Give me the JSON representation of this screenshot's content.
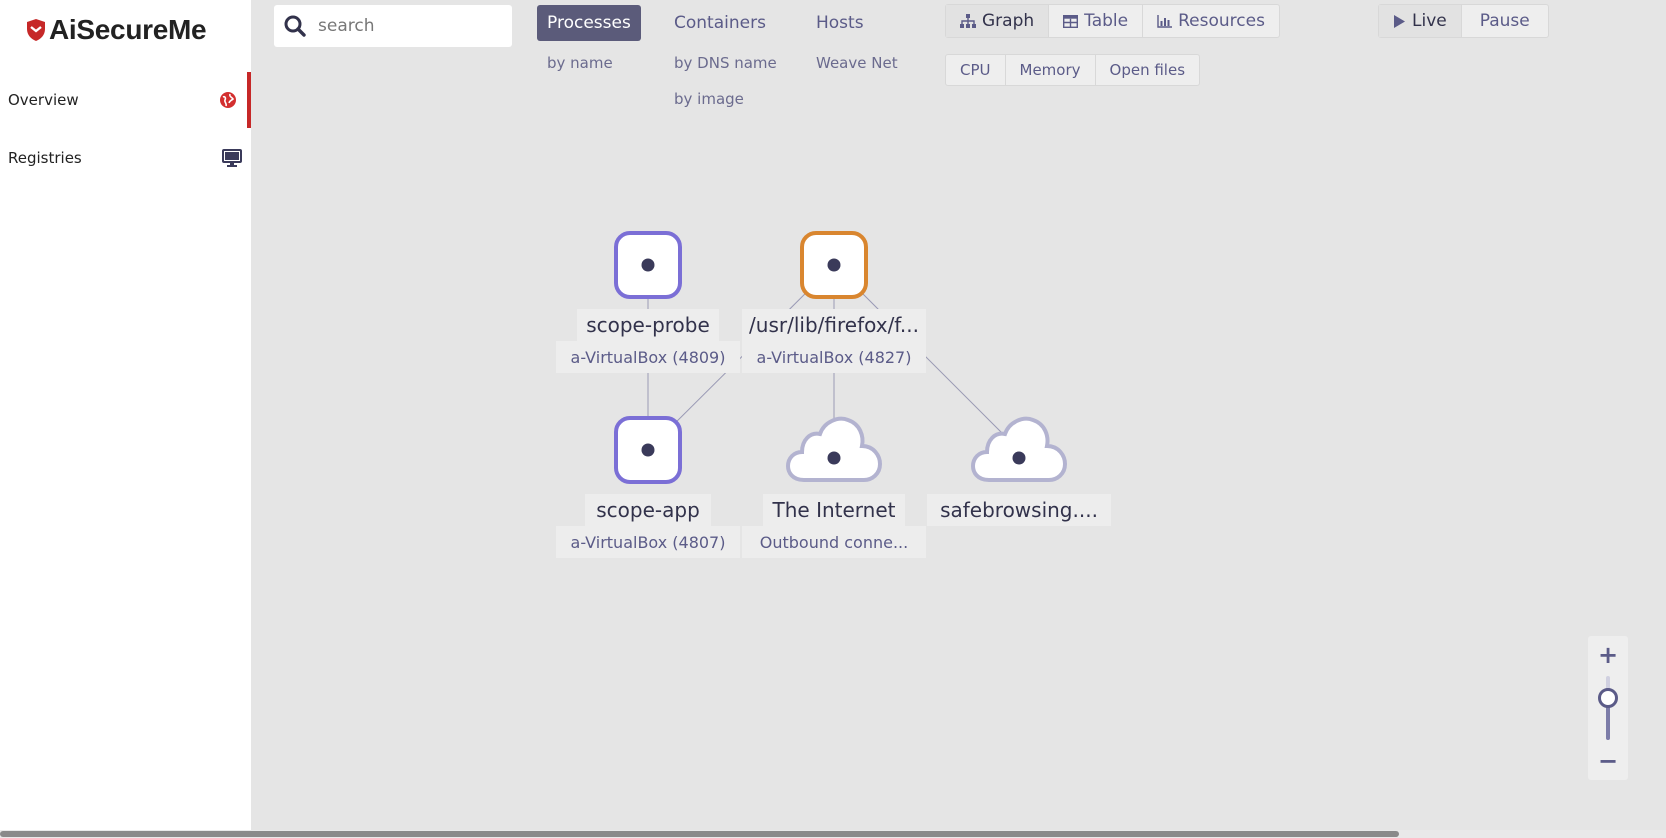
{
  "brand": {
    "name": "AiSecureMe",
    "accent": "#c62828"
  },
  "sidebar": {
    "items": [
      {
        "label": "Overview",
        "icon": "globe-icon",
        "active": true
      },
      {
        "label": "Registries",
        "icon": "monitor-icon",
        "active": false
      }
    ]
  },
  "search": {
    "placeholder": "search",
    "value": ""
  },
  "topologies": [
    {
      "label": "Processes",
      "active": true,
      "subs": [
        "by name"
      ]
    },
    {
      "label": "Containers",
      "active": false,
      "subs": [
        "by DNS name",
        "by image"
      ]
    },
    {
      "label": "Hosts",
      "active": false,
      "subs": [
        "Weave Net"
      ]
    }
  ],
  "view_modes": [
    {
      "label": "Graph",
      "icon": "sitemap-icon",
      "active": true
    },
    {
      "label": "Table",
      "icon": "table-icon",
      "active": false
    },
    {
      "label": "Resources",
      "icon": "bar-chart-icon",
      "active": false
    }
  ],
  "metrics": [
    "CPU",
    "Memory",
    "Open files"
  ],
  "playback": [
    {
      "label": "Live",
      "icon": "play-icon",
      "active": true
    },
    {
      "label": "Pause",
      "icon": "",
      "active": false
    }
  ],
  "nodes": [
    {
      "id": "scope-probe",
      "label": "scope-probe",
      "sublabel": "a-VirtualBox (4809)",
      "shape": "square",
      "color": "#7b6fd6"
    },
    {
      "id": "firefox",
      "label": "/usr/lib/firefox/f...",
      "sublabel": "a-VirtualBox (4827)",
      "shape": "square",
      "color": "#d9862f"
    },
    {
      "id": "scope-app",
      "label": "scope-app",
      "sublabel": "a-VirtualBox (4807)",
      "shape": "square",
      "color": "#7b6fd6"
    },
    {
      "id": "internet",
      "label": "The Internet",
      "sublabel": "Outbound conne...",
      "shape": "cloud",
      "color": "#b3b3d0"
    },
    {
      "id": "safebrowsing",
      "label": "safebrowsing....",
      "sublabel": "",
      "shape": "cloud",
      "color": "#b3b3d0"
    }
  ],
  "edges": [
    [
      "scope-probe",
      "scope-app"
    ],
    [
      "firefox",
      "scope-app"
    ],
    [
      "firefox",
      "internet"
    ],
    [
      "firefox",
      "safebrowsing"
    ]
  ],
  "zoom": {
    "level": 0.65
  },
  "scroll": {
    "fraction": 0.84
  }
}
